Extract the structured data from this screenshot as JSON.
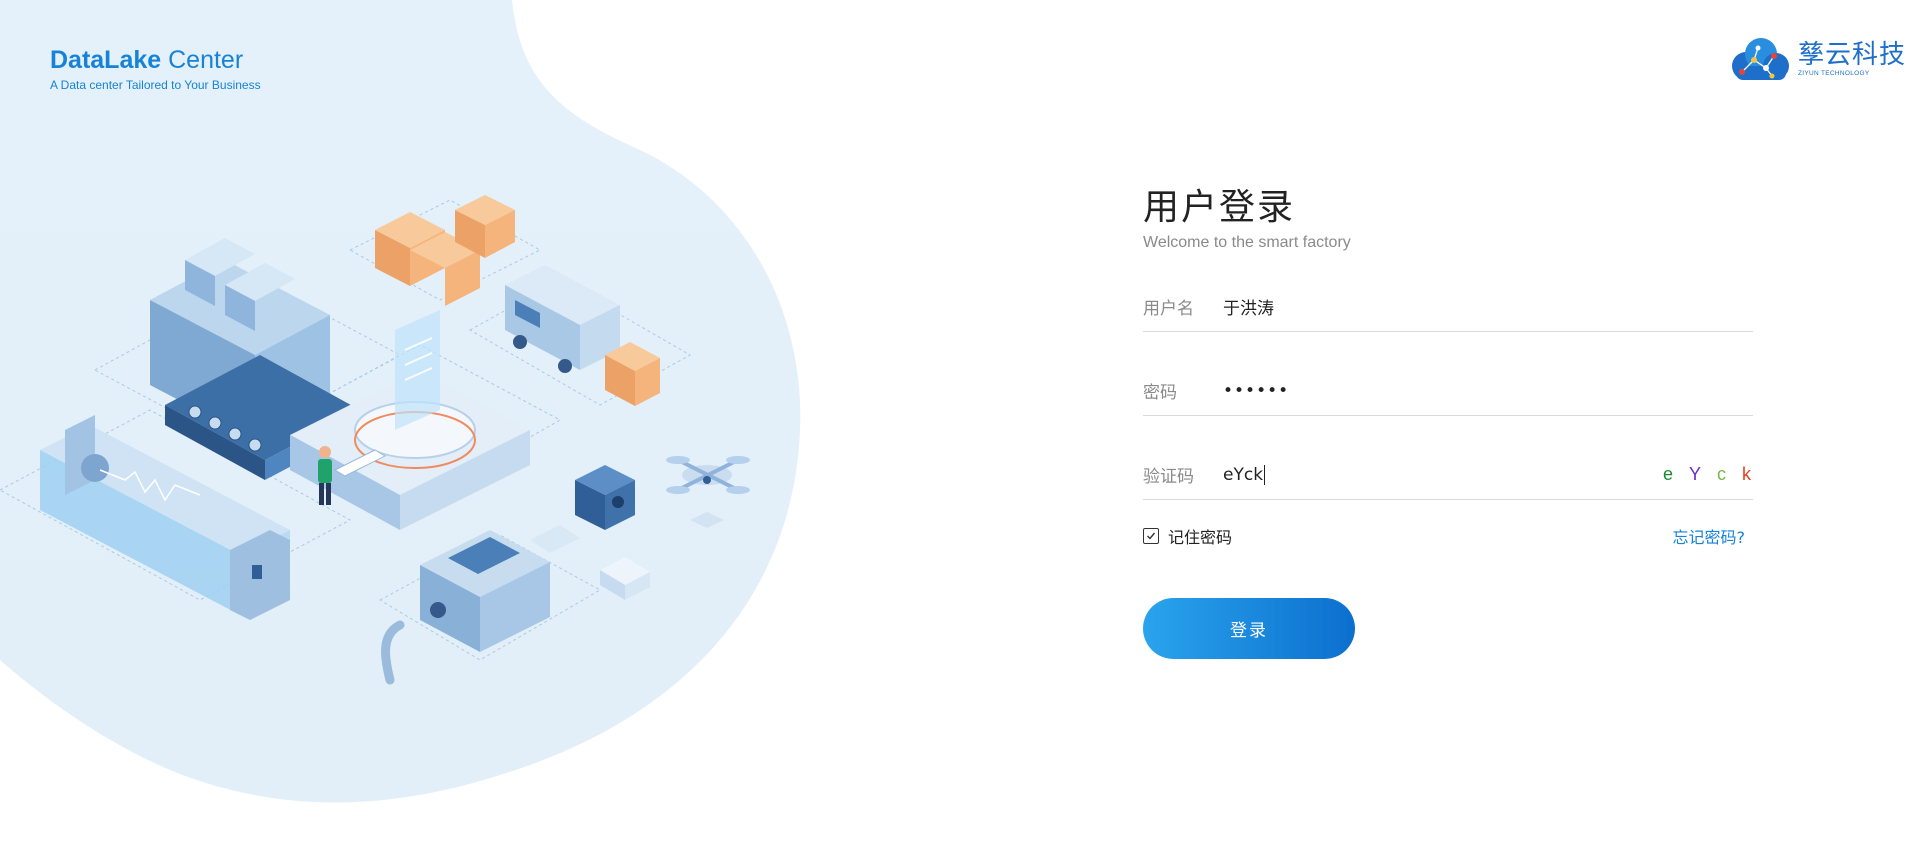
{
  "brand": {
    "title_bold": "DataLake",
    "title_light": "Center",
    "tagline": "A Data center Tailored to Your Business"
  },
  "logo": {
    "name_cn": "孳云科技",
    "name_en": "ZIYUN TECHNOLOGY"
  },
  "login": {
    "title": "用户登录",
    "subtitle": "Welcome to the smart factory",
    "username": {
      "label": "用户名",
      "value": "于洪涛"
    },
    "password": {
      "label": "密码",
      "masked_value": "••••••"
    },
    "captcha": {
      "label": "验证码",
      "value": "eYck",
      "chars": [
        {
          "char": "e",
          "color": "#1a8a2e"
        },
        {
          "char": "Y",
          "color": "#6a2bd0"
        },
        {
          "char": "c",
          "color": "#7ab648"
        },
        {
          "char": "k",
          "color": "#e5421d"
        }
      ]
    },
    "remember_label": "记住密码",
    "remember_checked": true,
    "forgot_label": "忘记密码?",
    "submit_label": "登录"
  },
  "colors": {
    "accent": "#1683d8",
    "blob": "#e3f0fa",
    "button_start": "#2aa4ec",
    "button_end": "#0c6fcf"
  }
}
